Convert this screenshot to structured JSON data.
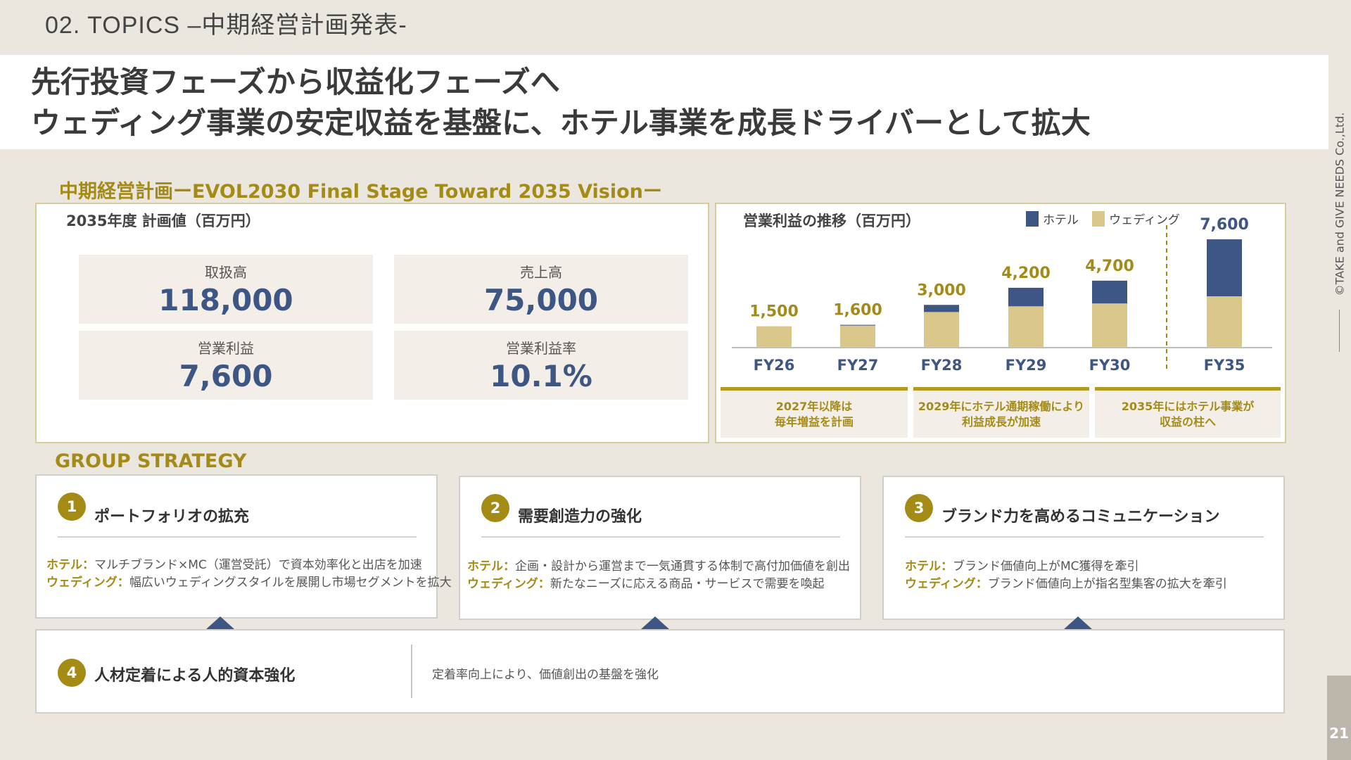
{
  "header": {
    "topic": "02.  TOPICS  –中期経営計画発表-",
    "headline_line1": "先行投資フェーズから収益化フェーズへ",
    "headline_line2": "ウェディング事業の安定収益を基盤に、ホテル事業を成長ドライバーとして拡大"
  },
  "side": {
    "copyright": "©TAKE and GIVE NEEDS Co.,Ltd.",
    "page_number": "21"
  },
  "plan": {
    "section_title": "中期経営計画ーEVOL2030 Final Stage Toward 2035 Visionー",
    "panel_label": "2035年度 計画値（百万円）",
    "kpis": [
      {
        "label": "取扱高",
        "value": "118,000"
      },
      {
        "label": "売上高",
        "value": "75,000"
      },
      {
        "label": "営業利益",
        "value": "7,600"
      },
      {
        "label": "営業利益率",
        "value": "10.1%"
      }
    ]
  },
  "chart_panel": {
    "label": "営業利益の推移（百万円）",
    "notes": [
      "2027年以降は\n毎年増益を計画",
      "2029年にホテル通期稼働により\n利益成長が加速",
      "2035年にはホテル事業が\n収益の柱へ"
    ]
  },
  "chart_data": {
    "type": "bar",
    "stacked": true,
    "title": "営業利益の推移（百万円）",
    "categories": [
      "FY26",
      "FY27",
      "FY28",
      "FY29",
      "FY30",
      "FY35"
    ],
    "totals_labels": [
      "1,500",
      "1,600",
      "3,000",
      "4,200",
      "4,700",
      "7,600"
    ],
    "series": [
      {
        "name": "ウェディング",
        "values": [
          1500,
          1550,
          2500,
          2900,
          3100,
          3600
        ],
        "color": "#d9c78c"
      },
      {
        "name": "ホテル",
        "values": [
          0,
          50,
          500,
          1300,
          1600,
          4000
        ],
        "color": "#3d5684"
      }
    ],
    "ylim": [
      0,
      8000
    ],
    "legend": "top-right",
    "grid": false
  },
  "strategy": {
    "title": "GROUP STRATEGY",
    "cards": [
      {
        "number": "1",
        "title": "ポートフォリオの拡充",
        "lines": [
          {
            "key": "ホテル：",
            "text": "マルチブランド×MC（運営受託）で資本効率化と出店を加速"
          },
          {
            "key": "ウェディング：",
            "text": "幅広いウェディングスタイルを展開し市場セグメントを拡大"
          }
        ]
      },
      {
        "number": "2",
        "title": "需要創造力の強化",
        "lines": [
          {
            "key": "ホテル：",
            "text": "企画・設計から運営まで一気通貫する体制で高付加価値を創出"
          },
          {
            "key": "ウェディング：",
            "text": "新たなニーズに応える商品・サービスで需要を喚起"
          }
        ]
      },
      {
        "number": "3",
        "title": "ブランド力を高めるコミュニケーション",
        "lines": [
          {
            "key": "ホテル：",
            "text": "ブランド価値向上がMC獲得を牽引"
          },
          {
            "key": "ウェディング：",
            "text": "ブランド価値向上が指名型集客の拡大を牽引"
          }
        ]
      }
    ],
    "bottom": {
      "number": "4",
      "title": "人材定着による人的資本強化",
      "text": "定着率向上により、価値創出の基盤を強化"
    }
  }
}
